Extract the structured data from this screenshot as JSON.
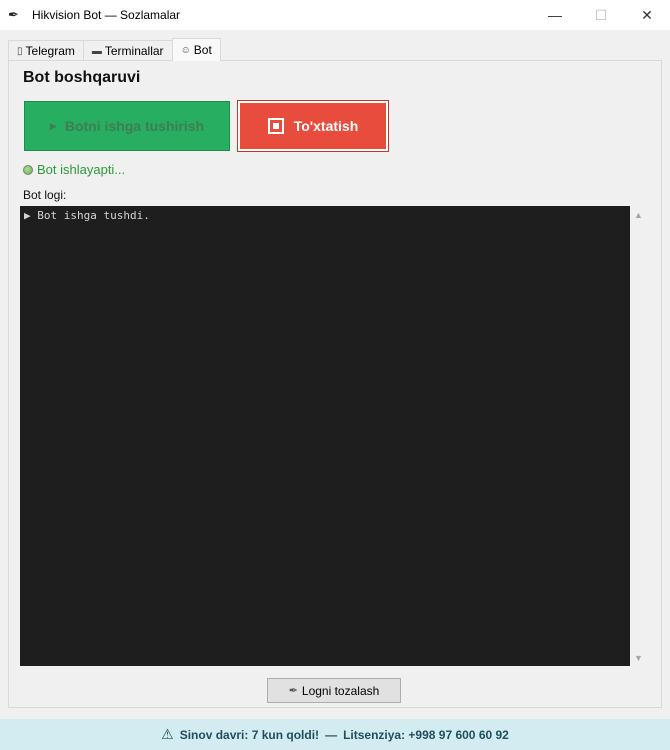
{
  "window": {
    "title": "Hikvision Bot — Sozlamalar",
    "app_icon": "feather-icon",
    "minimize": "—",
    "maximize": "☐",
    "close": "✕"
  },
  "tabs": [
    {
      "label": "Telegram",
      "icon": "phone-icon",
      "glyph": "▯",
      "active": false
    },
    {
      "label": "Terminallar",
      "icon": "monitor-icon",
      "glyph": "▬",
      "active": false
    },
    {
      "label": "Bot",
      "icon": "bot-icon",
      "glyph": "☺",
      "active": true
    }
  ],
  "bot_panel": {
    "title": "Bot boshqaruvi",
    "start_button": {
      "label": "Botni ishga tushirish",
      "icon": "play-icon",
      "glyph": "▶",
      "color": "#27ae60",
      "enabled": false
    },
    "stop_button": {
      "label": "To'xtatish",
      "icon": "stop-icon",
      "color": "#e74c3c",
      "enabled": true
    },
    "status_text": "Bot ishlayapti...",
    "status_color": "#2a9b3b",
    "log_label": "Bot logi:",
    "log_lines": [
      "▶ Bot ishga tushdi."
    ],
    "clear_button": {
      "label": "Logni tozalash",
      "icon": "broom-icon",
      "glyph": "🧹"
    }
  },
  "footer": {
    "icon": "warning-icon",
    "glyph": "⚠",
    "trial_text": "Sinov davri: 7 kun qoldi!",
    "separator": "—",
    "license_text": "Litsenziya: +998 97 600 60 92",
    "background": "#d3ecf1"
  }
}
